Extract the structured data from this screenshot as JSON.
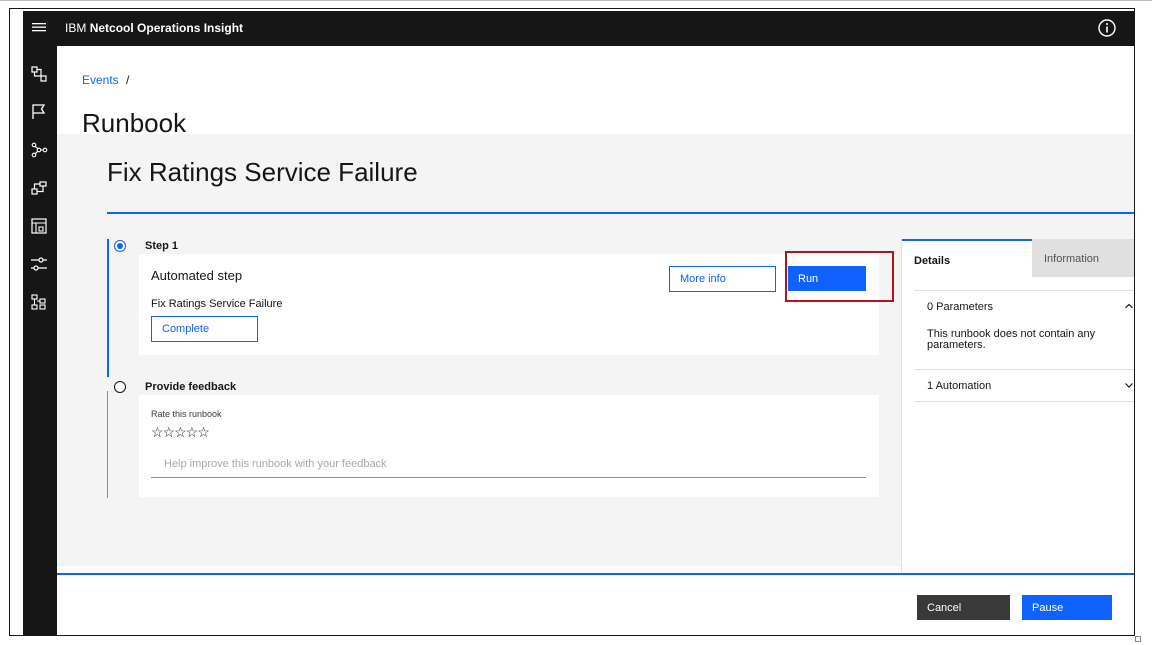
{
  "header": {
    "brand_prefix": "IBM",
    "brand_name": "Netcool Operations Insight",
    "icons": [
      "menu-icon",
      "info-icon",
      "user-icon"
    ]
  },
  "sidenav": {
    "icons": [
      "incident-icon",
      "flag-icon",
      "topology-icon",
      "workflow-icon",
      "dashboard-icon",
      "settings-sliders-icon",
      "hierarchy-icon"
    ]
  },
  "breadcrumb": {
    "items": [
      "Events"
    ],
    "separator": "/"
  },
  "page": {
    "title": "Runbook",
    "runbook_title": "Fix Ratings Service Failure"
  },
  "steps": [
    {
      "label": "Step 1",
      "card_title": "Automated step",
      "card_subtitle": "Fix Ratings Service Failure",
      "complete_label": "Complete",
      "more_info_label": "More info",
      "run_label": "Run",
      "selected": true
    },
    {
      "label": "Provide feedback",
      "rate_label": "Rate this runbook",
      "stars": "☆☆☆☆☆",
      "rating": 0,
      "feedback_placeholder": "Help improve this runbook with your feedback",
      "selected": false
    }
  ],
  "panel": {
    "tabs": [
      "Details",
      "Information"
    ],
    "active_tab": "Details",
    "parameters_heading": "0 Parameters",
    "parameters_body": "This runbook does not contain any parameters.",
    "automation_heading": "1 Automation"
  },
  "footer": {
    "cancel_label": "Cancel",
    "pause_label": "Pause"
  },
  "colors": {
    "accent": "#0f62fe",
    "header_bg": "#161616",
    "highlight": "#b3131c",
    "content_bg": "#f4f4f4"
  }
}
